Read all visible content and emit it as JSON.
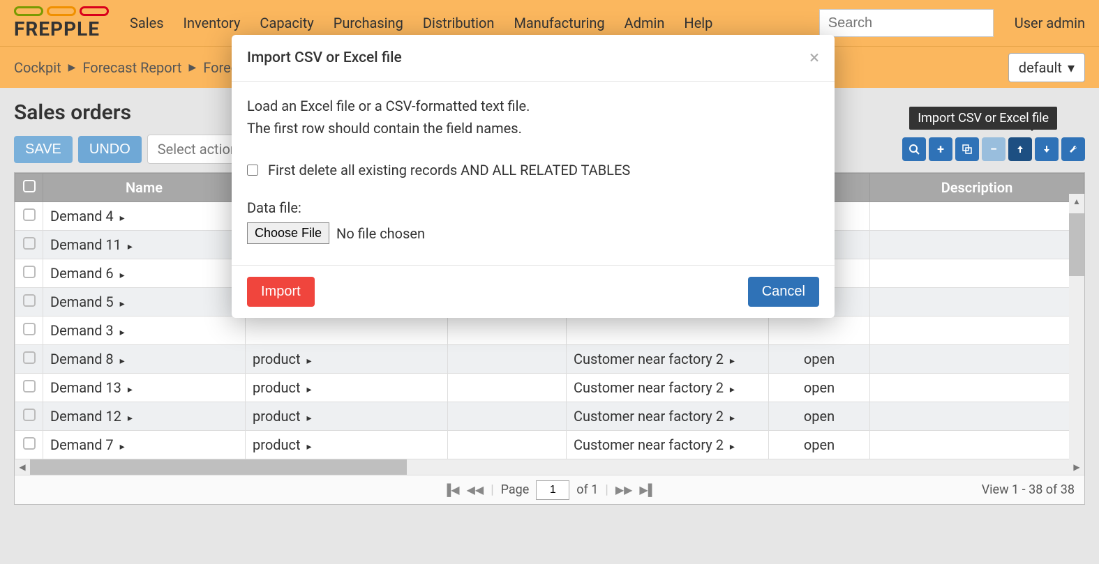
{
  "nav": {
    "items": [
      "Sales",
      "Inventory",
      "Capacity",
      "Purchasing",
      "Distribution",
      "Manufacturing",
      "Admin",
      "Help"
    ],
    "search_placeholder": "Search",
    "user": "User admin"
  },
  "breadcrumb": {
    "items": [
      "Cockpit",
      "Forecast Report",
      "Foreca"
    ],
    "scenario": "default"
  },
  "page": {
    "title": "Sales orders",
    "save": "SAVE",
    "undo": "UNDO",
    "select_action": "Select action",
    "tooltip": "Import CSV or Excel file"
  },
  "table": {
    "headers": {
      "name": "Name",
      "description": "Description"
    },
    "rows": [
      {
        "name": "Demand 4",
        "item": "",
        "location": "",
        "customer": "",
        "status": ""
      },
      {
        "name": "Demand 11",
        "item": "",
        "location": "",
        "customer": "",
        "status": ""
      },
      {
        "name": "Demand 6",
        "item": "",
        "location": "",
        "customer": "",
        "status": ""
      },
      {
        "name": "Demand 5",
        "item": "",
        "location": "",
        "customer": "",
        "status": ""
      },
      {
        "name": "Demand 3",
        "item": "",
        "location": "",
        "customer": "",
        "status": ""
      },
      {
        "name": "Demand 8",
        "item": "product",
        "location": "",
        "customer": "Customer near factory 2",
        "status": "open"
      },
      {
        "name": "Demand 13",
        "item": "product",
        "location": "",
        "customer": "Customer near factory 2",
        "status": "open"
      },
      {
        "name": "Demand 12",
        "item": "product",
        "location": "",
        "customer": "Customer near factory 2",
        "status": "open"
      },
      {
        "name": "Demand 7",
        "item": "product",
        "location": "",
        "customer": "Customer near factory 2",
        "status": "open"
      }
    ]
  },
  "pager": {
    "page_label": "Page",
    "current": "1",
    "of_label": "of 1",
    "view": "View 1 - 38 of 38"
  },
  "modal": {
    "title": "Import CSV or Excel file",
    "line1": "Load an Excel file or a CSV-formatted text file.",
    "line2": "The first row should contain the field names.",
    "checkbox_label": "First delete all existing records AND ALL RELATED TABLES",
    "datafile_label": "Data file:",
    "choose_file": "Choose File",
    "no_file": "No file chosen",
    "import": "Import",
    "cancel": "Cancel"
  }
}
